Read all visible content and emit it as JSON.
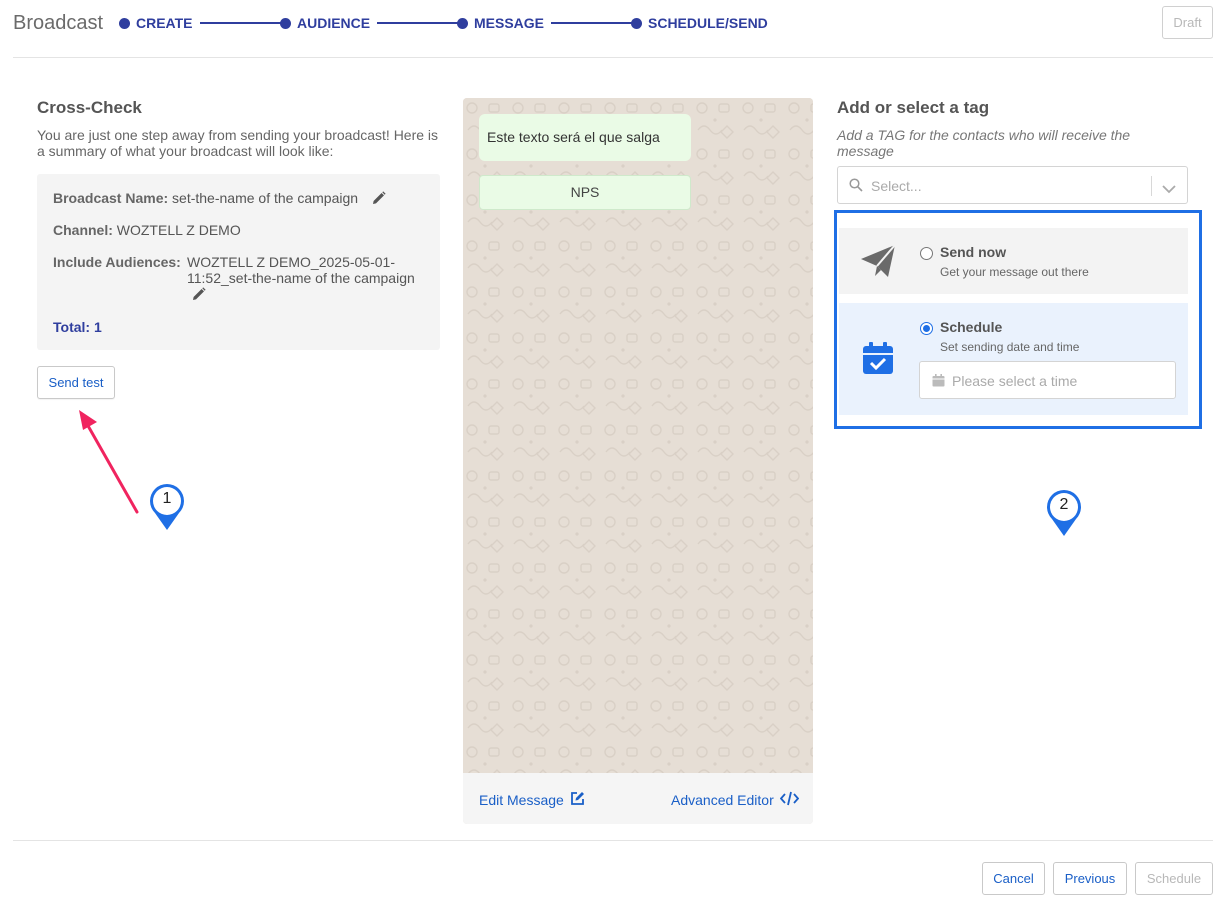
{
  "header": {
    "title": "Broadcast",
    "steps": [
      "CREATE",
      "AUDIENCE",
      "MESSAGE",
      "SCHEDULE/SEND"
    ],
    "draft_label": "Draft"
  },
  "crosscheck": {
    "title": "Cross-Check",
    "description": "You are just one step away from sending your broadcast! Here is a summary of what your broadcast will look like:",
    "name_label": "Broadcast Name:",
    "name_value": "set-the-name of the campaign",
    "channel_label": "Channel:",
    "channel_value": "WOZTELL Z DEMO",
    "audiences_label": "Include Audiences:",
    "audiences_value_line1": "WOZTELL Z DEMO_2025-05-01-",
    "audiences_value_line2": "11:52_set-the-name of the campaign",
    "total_label": "Total:",
    "total_value": "1",
    "send_test_label": "Send test"
  },
  "preview": {
    "message_text": "Este texto será el que salga",
    "button_label": "NPS",
    "edit_label": "Edit Message",
    "advanced_label": "Advanced Editor"
  },
  "tag": {
    "title": "Add or select a tag",
    "hint": "Add a TAG for the contacts who will receive the message",
    "placeholder": "Select..."
  },
  "send_options": {
    "now_title": "Send now",
    "now_sub": "Get your message out there",
    "schedule_title": "Schedule",
    "schedule_sub": "Set sending date and time",
    "time_placeholder": "Please select a time",
    "selected": "schedule"
  },
  "markers": {
    "first": "1",
    "second": "2"
  },
  "footer": {
    "cancel": "Cancel",
    "previous": "Previous",
    "schedule": "Schedule"
  },
  "colors": {
    "brand_blue": "#2f3e9e",
    "link_blue": "#1a5fc7",
    "highlight_blue": "#1f6fe5",
    "arrow_pink": "#f0245f",
    "bubble_green": "#eafbe6",
    "chat_bg": "#e6ded5"
  },
  "icons": [
    "pencil-icon",
    "edit-icon",
    "code-icon",
    "search-icon",
    "chevron-down-icon",
    "paper-plane-icon",
    "calendar-check-icon",
    "calendar-icon",
    "map-pin-icon",
    "arrow-icon"
  ]
}
